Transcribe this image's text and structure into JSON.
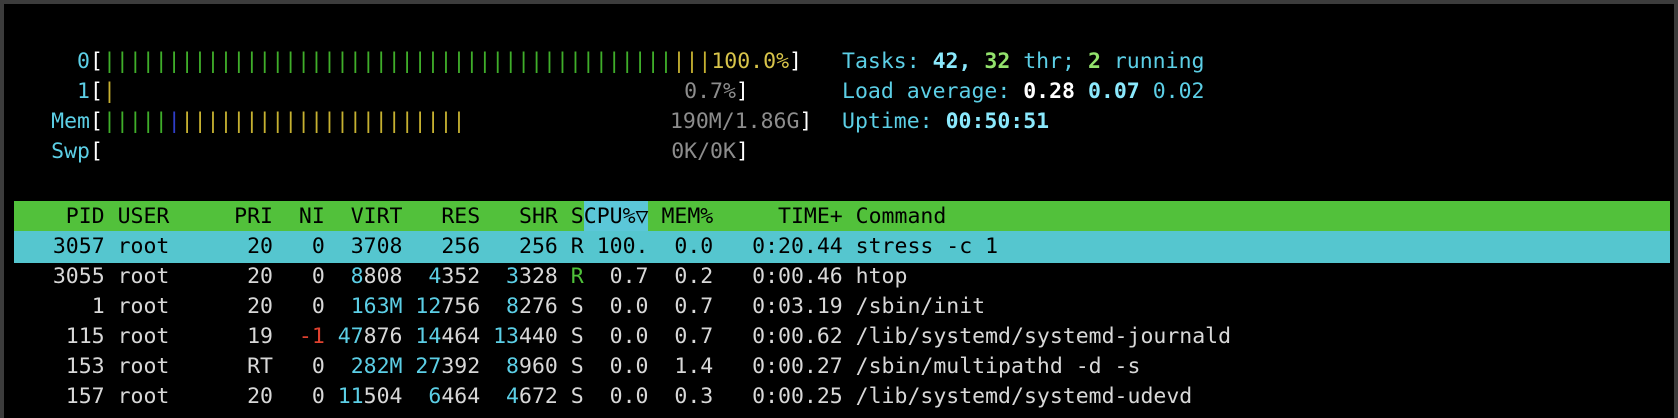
{
  "meters": {
    "cpu0": {
      "label": "0",
      "bar_green": "||||||||||||||||||||||||||||||||||||||||||||",
      "bar_yellow": "|||",
      "value": "100.0%",
      "fill": 1.0
    },
    "cpu1": {
      "label": "1",
      "bar_yellow": "|",
      "value": "0.7%",
      "fill": 0.007
    },
    "mem": {
      "label": "Mem",
      "bar_green": "|||||",
      "bar_blue": "|",
      "bar_yellow": "||||||||||||||||||||||",
      "value": "190M/1.86G",
      "fill": 0.1
    },
    "swp": {
      "label": "Swp",
      "value": "0K/0K",
      "fill": 0.0
    }
  },
  "summary": {
    "tasks_label": "Tasks: ",
    "tasks": "42",
    "thr_sep": ", ",
    "threads": "32",
    "thr_label": " thr; ",
    "running": "2",
    "running_label": " running",
    "load_label": "Load average: ",
    "load1": "0.28",
    "load5": "0.07",
    "load15": "0.02",
    "uptime_label": "Uptime: ",
    "uptime": "00:50:51"
  },
  "columns": [
    "PID",
    "USER",
    "PRI",
    "NI",
    "VIRT",
    "RES",
    "SHR",
    "S",
    "CPU%▽",
    "MEM%",
    "TIME+",
    "Command"
  ],
  "sort_column": "CPU%▽",
  "processes": [
    {
      "pid": "3057",
      "user": "root",
      "pri": "20",
      "ni": "0",
      "virt": "3708",
      "res": "256",
      "shr": "256",
      "s": "R",
      "cpu": "100.",
      "mem": "0.0",
      "time": "0:20.44",
      "cmd": "stress -c 1",
      "selected": true
    },
    {
      "pid": "3055",
      "user": "root",
      "pri": "20",
      "ni": "0",
      "virt": "8808",
      "res": "4352",
      "shr": "3328",
      "s": "R",
      "cpu": "0.7",
      "mem": "0.2",
      "time": "0:00.46",
      "cmd": "htop"
    },
    {
      "pid": "1",
      "user": "root",
      "pri": "20",
      "ni": "0",
      "virt": "163M",
      "res": "12756",
      "shr": "8276",
      "s": "S",
      "cpu": "0.0",
      "mem": "0.7",
      "time": "0:03.19",
      "cmd": "/sbin/init"
    },
    {
      "pid": "115",
      "user": "root",
      "pri": "19",
      "ni": "-1",
      "virt": "47876",
      "res": "14464",
      "shr": "13440",
      "s": "S",
      "cpu": "0.0",
      "mem": "0.7",
      "time": "0:00.62",
      "cmd": "/lib/systemd/systemd-journald"
    },
    {
      "pid": "153",
      "user": "root",
      "pri": "RT",
      "ni": "0",
      "virt": "282M",
      "res": "27392",
      "shr": "8960",
      "s": "S",
      "cpu": "0.0",
      "mem": "1.4",
      "time": "0:00.27",
      "cmd": "/sbin/multipathd -d -s"
    },
    {
      "pid": "157",
      "user": "root",
      "pri": "20",
      "ni": "0",
      "virt": "11504",
      "res": "6464",
      "shr": "4672",
      "s": "S",
      "cpu": "0.0",
      "mem": "0.3",
      "time": "0:00.25",
      "cmd": "/lib/systemd/systemd-udevd"
    }
  ]
}
